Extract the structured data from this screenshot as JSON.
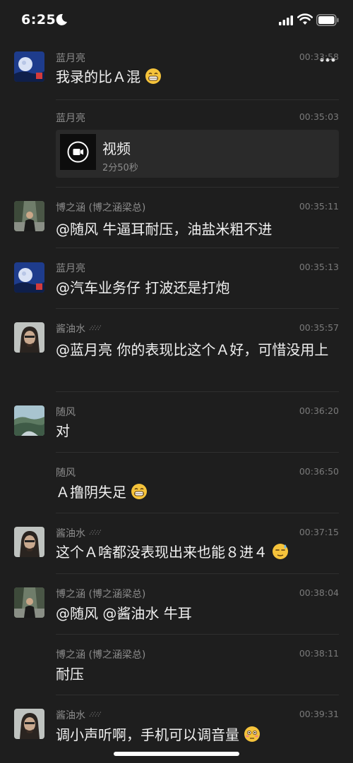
{
  "status_bar": {
    "time": "6:25",
    "icons": [
      "moon-icon",
      "signal-icon",
      "wifi-icon",
      "battery-icon"
    ]
  },
  "toolbar": {
    "more_icon": "more-icon"
  },
  "messages": [
    {
      "sender": "蓝月亮",
      "time": "00:33:58",
      "text": "我录的比Ａ混",
      "emoji": "grin-emoji",
      "avatar": "avatar-moon"
    },
    {
      "sender": "蓝月亮",
      "time": "00:35:03",
      "video": {
        "title": "视频",
        "duration": "2分50秒"
      }
    },
    {
      "sender": "博之涵 (博之涵梁总)",
      "time": "00:35:11",
      "text": "@随风 牛逼耳耐压，油盐米粗不进",
      "avatar": "avatar-man"
    },
    {
      "sender": "蓝月亮",
      "time": "00:35:13",
      "text": "@汽车业务仔 打波还是打炮",
      "avatar": "avatar-moon"
    },
    {
      "sender": "酱油水",
      "time": "00:35:57",
      "text": "@蓝月亮 你的表现比这个Ａ好，可惜没用上",
      "avatar": "avatar-depp"
    },
    {
      "sender": "随风",
      "time": "00:36:20",
      "text": "对",
      "avatar": "avatar-landscape"
    },
    {
      "sender": "随风",
      "time": "00:36:50",
      "text": "Ａ撸阴失足",
      "emoji": "grin-emoji"
    },
    {
      "sender": "酱油水",
      "time": "00:37:15",
      "text": "这个Ａ啥都没表现出来也能８进４",
      "emoji": "sweat-emoji",
      "avatar": "avatar-depp"
    },
    {
      "sender": "博之涵 (博之涵梁总)",
      "time": "00:38:04",
      "text": "@随风 @酱油水 牛耳",
      "avatar": "avatar-man"
    },
    {
      "sender": "博之涵 (博之涵梁总)",
      "time": "00:38:11",
      "text": "耐压"
    },
    {
      "sender": "酱油水",
      "time": "00:39:31",
      "text": "调小声听啊，手机可以调音量",
      "emoji": "flushed-emoji",
      "avatar": "avatar-depp"
    }
  ],
  "colors": {
    "background": "#1e1e1e",
    "text": "#f0f0f0",
    "sender": "#8c8c8c",
    "time": "#7a7a7a"
  }
}
